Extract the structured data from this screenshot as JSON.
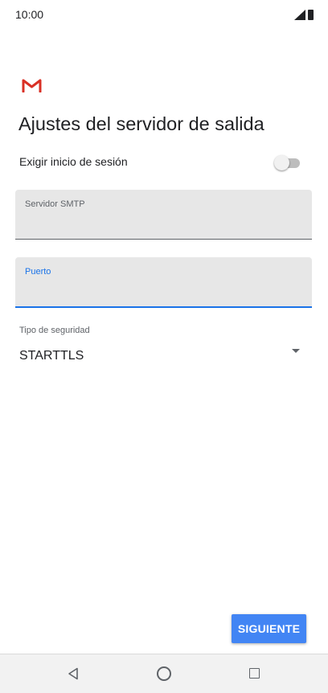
{
  "status_bar": {
    "time": "10:00",
    "icons": [
      "signal-icon",
      "battery-icon"
    ]
  },
  "header": {
    "logo_icon": "gmail-logo-icon",
    "title": "Ajustes del servidor de salida"
  },
  "require_login": {
    "label": "Exigir inicio de sesión",
    "enabled": false
  },
  "fields": {
    "smtp_server": {
      "label": "Servidor SMTP",
      "value": ""
    },
    "port": {
      "label": "Puerto",
      "value": ""
    }
  },
  "security": {
    "label": "Tipo de seguridad",
    "value": "STARTTLS"
  },
  "actions": {
    "next_label": "SIGUIENTE"
  },
  "colors": {
    "accent": "#1a73e8",
    "button": "#4285f4",
    "gmail_red": "#d93025"
  },
  "nav_bar": {
    "icons": [
      "back-icon",
      "home-icon",
      "recent-apps-icon"
    ]
  }
}
